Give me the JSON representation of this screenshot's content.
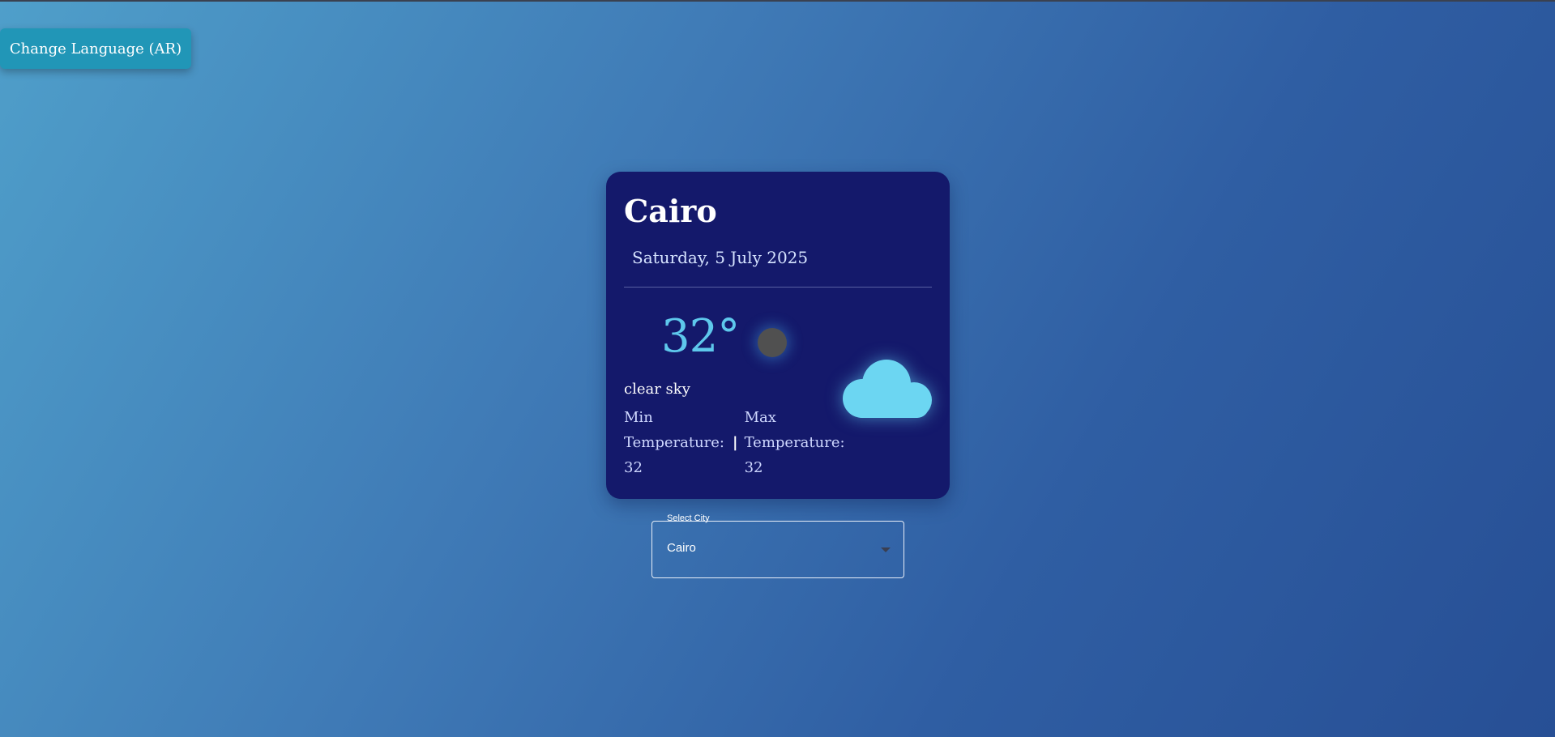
{
  "header": {
    "language_button_label": "Change Language (AR)"
  },
  "weather_card": {
    "city": "Cairo",
    "date": "Saturday, 5 July 2025",
    "temperature": "32°",
    "description": "clear sky",
    "min_label_line1": "Min",
    "min_label_line2": "Temperature:",
    "min_value": "32",
    "separator": "|",
    "max_label_line1": "Max",
    "max_label_line2": "Temperature:",
    "max_value": "32",
    "weather_icon": "cloud-icon",
    "status_icon": "weather-status-dot-icon"
  },
  "city_select": {
    "label": "Select City",
    "selected": "Cairo"
  },
  "colors": {
    "background_start": "#4f9fca",
    "background_end": "#274f95",
    "card_bg": "#14196b",
    "accent_cyan": "#5ec8ec",
    "button_bg": "#2196b7"
  }
}
